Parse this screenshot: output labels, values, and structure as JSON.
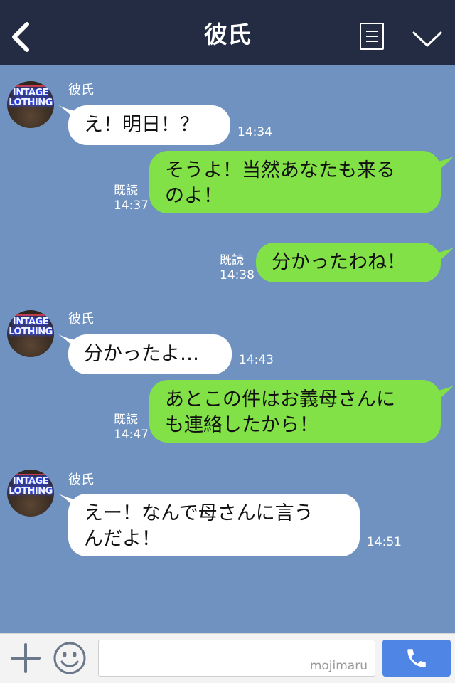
{
  "header": {
    "title": "彼氏"
  },
  "messages": [
    {
      "side": "in",
      "sender": "彼氏",
      "text": "え！明日！？",
      "time": "14:34"
    },
    {
      "side": "out",
      "read": "既読",
      "time": "14:37",
      "line1": "そうよ！当然あなたも来る",
      "line2": "のよ！"
    },
    {
      "side": "out",
      "read": "既読",
      "time": "14:38",
      "text": "分かったわね！"
    },
    {
      "side": "in",
      "sender": "彼氏",
      "text": "分かったよ…",
      "time": "14:43"
    },
    {
      "side": "out",
      "read": "既読",
      "time": "14:47",
      "line1": "あとこの件はお義母さんに",
      "line2": "も連絡したから！"
    },
    {
      "side": "in",
      "sender": "彼氏",
      "time": "14:51",
      "line1": "えー！なんで母さんに言う",
      "line2": "んだよ！"
    }
  ],
  "avatar": {
    "line1": "INTAGE",
    "line2": "LOTHING"
  },
  "footer": {
    "watermark": "mojimaru"
  },
  "colors": {
    "header_bg": "#232c42",
    "chat_bg": "#6f92c1",
    "out_bubble": "#82e146",
    "in_bubble": "#ffffff",
    "call_button": "#4f86e6"
  },
  "icons": {
    "back": "back-chevron-icon",
    "menu": "menu-list-icon",
    "collapse": "chevron-down-icon",
    "add": "plus-icon",
    "emoji": "smiley-icon",
    "call": "phone-icon"
  }
}
